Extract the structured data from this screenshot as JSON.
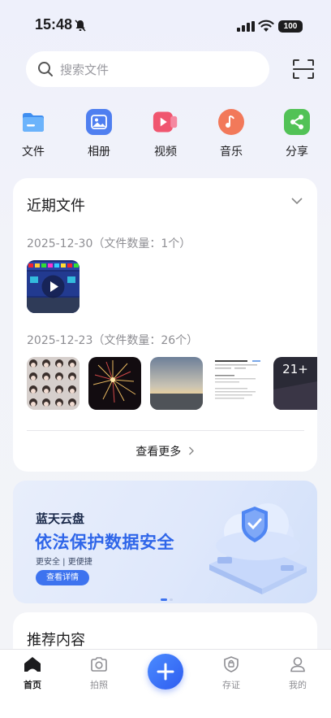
{
  "status": {
    "time": "15:48",
    "battery": "100"
  },
  "search": {
    "placeholder": "搜索文件"
  },
  "quick_actions": [
    {
      "label": "文件",
      "icon": "folder-icon",
      "color": "#4a9cf5"
    },
    {
      "label": "相册",
      "icon": "photo-icon",
      "color": "#4f7ff0"
    },
    {
      "label": "视频",
      "icon": "video-icon",
      "color": "#f0566f"
    },
    {
      "label": "音乐",
      "icon": "music-icon",
      "color": "#f2795a"
    },
    {
      "label": "分享",
      "icon": "share-icon",
      "color": "#52c256"
    }
  ],
  "recent": {
    "title": "近期文件",
    "groups": [
      {
        "date": "2025-12-30（文件数量：1个）"
      },
      {
        "date": "2025-12-23（文件数量：26个）",
        "overflow_badge": "21+"
      }
    ],
    "more_label": "查看更多"
  },
  "banner": {
    "brand": "蓝天云盘",
    "headline": "依法保护数据安全",
    "subtitle": "更安全 | 更便捷",
    "button": "查看详情"
  },
  "recommend": {
    "title": "推荐内容"
  },
  "tabs": [
    {
      "label": "首页",
      "icon": "home-icon",
      "active": true
    },
    {
      "label": "拍照",
      "icon": "camera-icon",
      "active": false
    },
    {
      "label": "存证",
      "icon": "certificate-icon",
      "active": false
    },
    {
      "label": "我的",
      "icon": "profile-icon",
      "active": false
    }
  ],
  "colors": {
    "accent": "#2f66e9",
    "fab": "#3d73ef"
  }
}
